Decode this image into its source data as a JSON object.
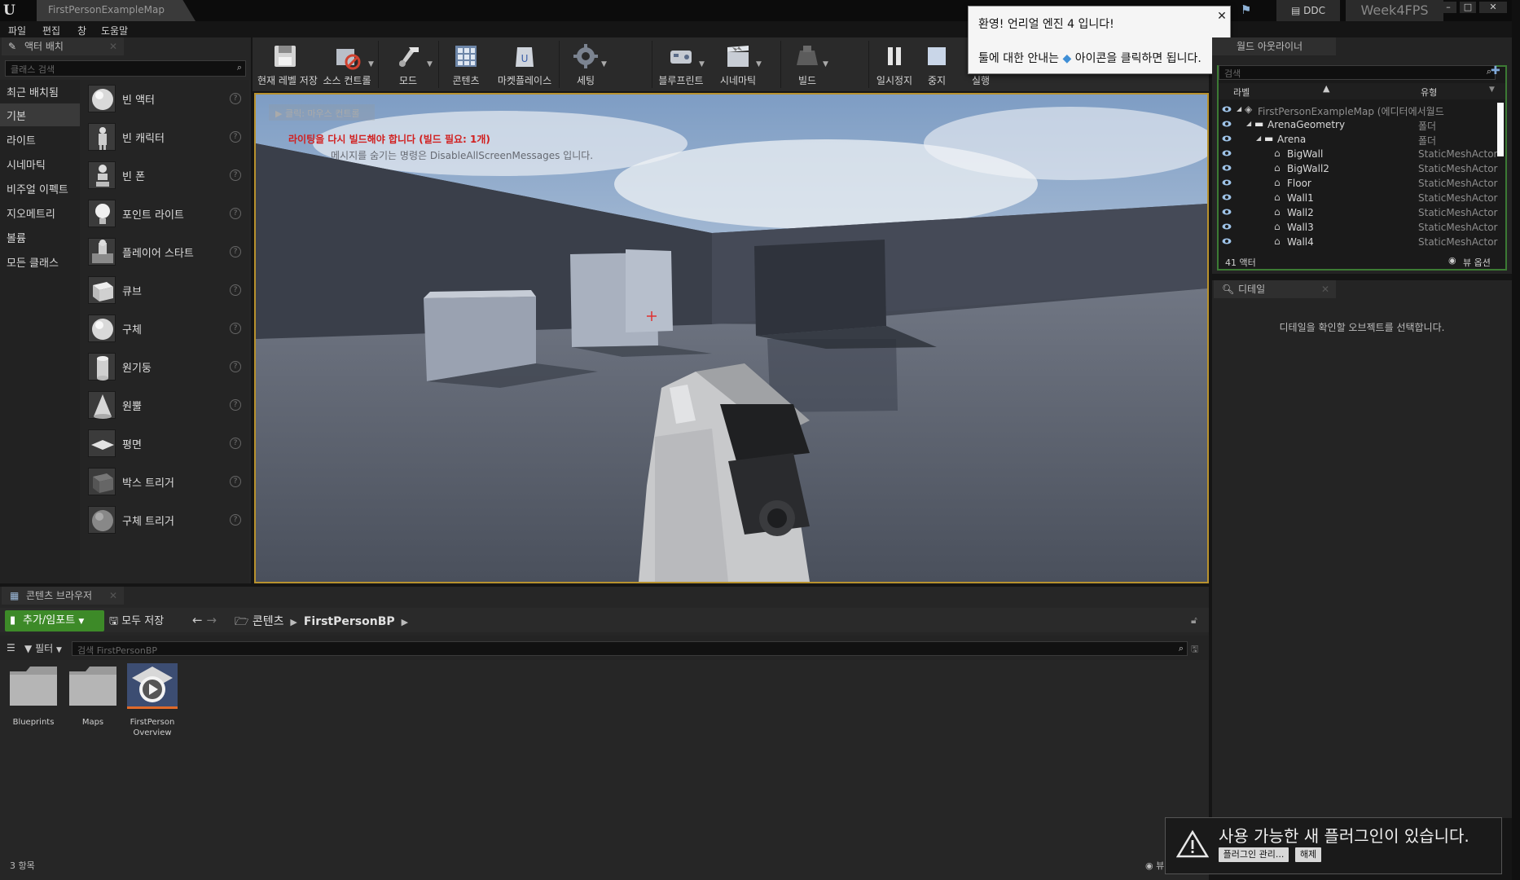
{
  "titlebar": {
    "map_tab": "FirstPersonExampleMap",
    "ddc_label": "DDC",
    "project_name": "Week4FPS"
  },
  "menu": [
    "파일",
    "편집",
    "창",
    "도움말"
  ],
  "place_actors": {
    "tab_label": "액터 배치",
    "search_placeholder": "클래스 검색",
    "categories": [
      "최근 배치됨",
      "기본",
      "라이트",
      "시네마틱",
      "비주얼 이펙트",
      "지오메트리",
      "볼륨",
      "모든 클래스"
    ],
    "active_category": "기본",
    "assets": [
      {
        "label": "빈 액터",
        "icon": "sphere-icon"
      },
      {
        "label": "빈 캐릭터",
        "icon": "character-icon"
      },
      {
        "label": "빈 폰",
        "icon": "pawn-icon"
      },
      {
        "label": "포인트 라이트",
        "icon": "point-light-icon"
      },
      {
        "label": "플레이어 스타트",
        "icon": "player-start-icon"
      },
      {
        "label": "큐브",
        "icon": "cube-icon"
      },
      {
        "label": "구체",
        "icon": "sphere-icon"
      },
      {
        "label": "원기둥",
        "icon": "cylinder-icon"
      },
      {
        "label": "원뿔",
        "icon": "cone-icon"
      },
      {
        "label": "평면",
        "icon": "plane-icon"
      },
      {
        "label": "박스 트리거",
        "icon": "box-trigger-icon"
      },
      {
        "label": "구체 트리거",
        "icon": "sphere-trigger-icon"
      }
    ],
    "help_glyph": "?"
  },
  "toolbar": {
    "buttons": [
      {
        "label": "현재 레벨 저장",
        "icon": "save-icon"
      },
      {
        "label": "소스 컨트롤",
        "icon": "source-control-icon"
      },
      {
        "label": "모드",
        "icon": "modes-icon"
      },
      {
        "label": "콘텐츠",
        "icon": "content-icon"
      },
      {
        "label": "마켓플레이스",
        "icon": "marketplace-icon"
      },
      {
        "label": "세팅",
        "icon": "settings-icon"
      },
      {
        "label": "블루프린트",
        "icon": "blueprint-icon"
      },
      {
        "label": "시네마틱",
        "icon": "cinematics-icon"
      },
      {
        "label": "빌드",
        "icon": "build-icon"
      },
      {
        "label": "일시정지",
        "icon": "pause-icon"
      },
      {
        "label": "중지",
        "icon": "stop-icon"
      },
      {
        "label": "실행",
        "icon": "launch-icon"
      }
    ]
  },
  "viewport": {
    "collapse_label": "클릭: 마우스 컨트롤",
    "warning": "라이팅을 다시 빌드해야 합니다 (빌드 필요: 1개)",
    "hint": "메시지를 숨기는 명령은 DisableAllScreenMessages 입니다."
  },
  "welcome": {
    "title": "환영! 언리얼 엔진 4 입니다!",
    "body_before": "툴에 대한 안내는",
    "body_after": "아이콘을 클릭하면 됩니다.",
    "close": "✕"
  },
  "outliner": {
    "tab_label": "월드 아웃라이너",
    "search_placeholder": "검색",
    "col_label": "라벨",
    "col_type": "유형",
    "rows": [
      {
        "label": "FirstPersonExampleMap (에디터에서월드",
        "type": "",
        "indent": 0,
        "kind": "world",
        "dim": true
      },
      {
        "label": "ArenaGeometry",
        "type": "폴더",
        "indent": 1,
        "kind": "folder",
        "dim": false
      },
      {
        "label": "Arena",
        "type": "폴더",
        "indent": 2,
        "kind": "folder",
        "dim": false
      },
      {
        "label": "BigWall",
        "type": "StaticMeshActor",
        "indent": 3,
        "kind": "actor",
        "dim": false
      },
      {
        "label": "BigWall2",
        "type": "StaticMeshActor",
        "indent": 3,
        "kind": "actor",
        "dim": false
      },
      {
        "label": "Floor",
        "type": "StaticMeshActor",
        "indent": 3,
        "kind": "actor",
        "dim": false
      },
      {
        "label": "Wall1",
        "type": "StaticMeshActor",
        "indent": 3,
        "kind": "actor",
        "dim": false
      },
      {
        "label": "Wall2",
        "type": "StaticMeshActor",
        "indent": 3,
        "kind": "actor",
        "dim": false
      },
      {
        "label": "Wall3",
        "type": "StaticMeshActor",
        "indent": 3,
        "kind": "actor",
        "dim": false
      },
      {
        "label": "Wall4",
        "type": "StaticMeshActor",
        "indent": 3,
        "kind": "actor",
        "dim": false
      }
    ],
    "actor_count": "41 액터",
    "view_options": "뷰 옵션"
  },
  "details": {
    "tab_label": "디테일",
    "empty_text": "디테일을 확인할 오브젝트를 선택합니다."
  },
  "content_browser": {
    "tab_label": "콘텐츠 브라우저",
    "add_import": "추가/임포트",
    "save_all": "모두 저장",
    "crumbs": [
      "콘텐츠",
      "FirstPersonBP"
    ],
    "filter_label": "필터",
    "search_placeholder": "검색 FirstPersonBP",
    "items": [
      {
        "label": "Blueprints",
        "kind": "folder"
      },
      {
        "label": "Maps",
        "kind": "folder"
      },
      {
        "label": "FirstPerson Overview",
        "kind": "level"
      }
    ],
    "item_count": "3 항목",
    "view_options": "뷰 옵션"
  },
  "plugin_toast": {
    "title": "사용 가능한 새 플러그인이 있습니다.",
    "manage_button": "플러그인 관리...",
    "dismiss_button": "해제"
  },
  "colors": {
    "accent_green": "#3d8a28",
    "viewport_border": "#b8922e",
    "warning_red": "#d12020",
    "outliner_border": "#3c7a34"
  }
}
